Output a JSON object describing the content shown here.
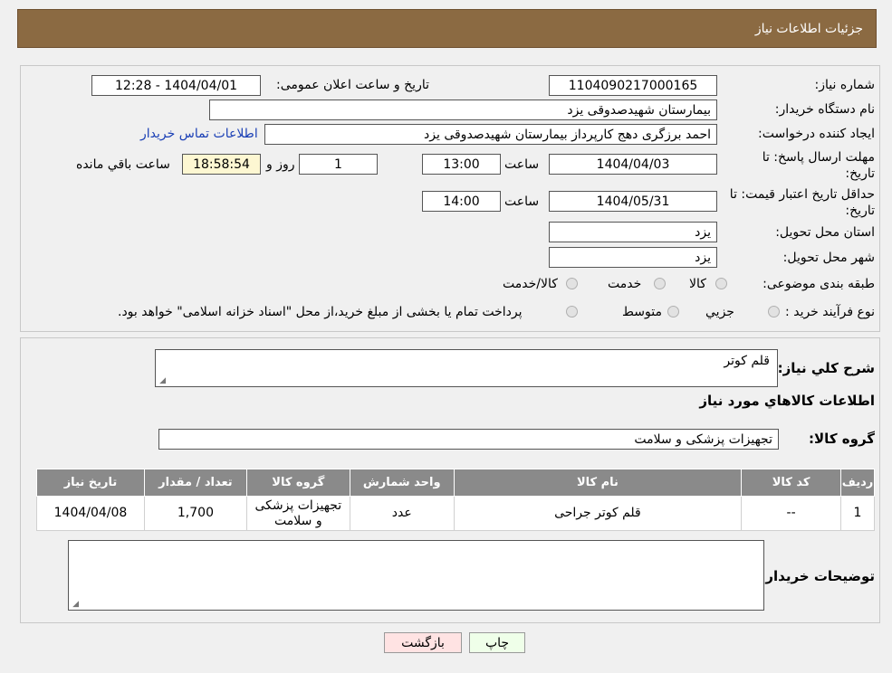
{
  "header": {
    "title": "جزئیات اطلاعات نیاز"
  },
  "form": {
    "need_number_label": "شماره نیاز:",
    "need_number": "1104090217000165",
    "announce_label": "تاریخ و ساعت اعلان عمومی:",
    "announce_value": "1404/04/01 - 12:28",
    "buyer_org_label": "نام دستگاه خریدار:",
    "buyer_org": "بیمارستان شهیدصدوقی یزد",
    "requester_label": "ایجاد کننده درخواست:",
    "requester": "احمد برزگری دهج کارپرداز بیمارستان شهیدصدوقی یزد",
    "contact_link": "اطلاعات تماس خریدار",
    "deadline_label_1": "مهلت ارسال پاسخ: تا",
    "deadline_label_2": "تاریخ:",
    "deadline_date": "1404/04/03",
    "time_label": "ساعت",
    "deadline_time": "13:00",
    "days_value": "1",
    "days_label": "روز و",
    "remaining_time": "18:58:54",
    "remaining_label": "ساعت باقي مانده",
    "validity_label_1": "حداقل تاریخ اعتبار قیمت: تا",
    "validity_label_2": "تاریخ:",
    "validity_date": "1404/05/31",
    "validity_time": "14:00",
    "province_label": "استان محل تحویل:",
    "province": "یزد",
    "city_label": "شهر محل تحویل:",
    "city": "یزد",
    "category_label": "طبقه بندی موضوعی:",
    "category_options": [
      "کالا",
      "خدمت",
      "کالا/خدمت"
    ],
    "process_label": "نوع فرآیند خرید :",
    "process_options": [
      "جزيي",
      "متوسط"
    ],
    "process_note": "پرداخت تمام یا بخشی از مبلغ خرید،از محل \"اسناد خزانه اسلامی\" خواهد بود."
  },
  "details": {
    "summary_label": "شرح کلي نياز:",
    "summary": "قلم کوتر",
    "goods_title": "اطلاعات کالاهاي مورد نياز",
    "group_label": "گروه کالا:",
    "group": "تجهیزات پزشکی و سلامت",
    "table_headers": [
      "رديف",
      "کد کالا",
      "نام کالا",
      "واحد شمارش",
      "گروه کالا",
      "تعداد / مقدار",
      "تاریخ نیاز"
    ],
    "rows": [
      [
        "1",
        "--",
        "قلم کوتر جراحی",
        "عدد",
        "تجهیزات پزشکی و سلامت",
        "1,700",
        "1404/04/08"
      ]
    ],
    "buyer_notes_label": "توضیحات خریدار:",
    "buyer_notes": ""
  },
  "buttons": {
    "print": "چاپ",
    "back": "بازگشت"
  },
  "colors": {
    "header": "#8b6a42",
    "table_header": "#8a8a8a",
    "print_bg": "#efffe9",
    "back_bg": "#ffe3e3"
  }
}
